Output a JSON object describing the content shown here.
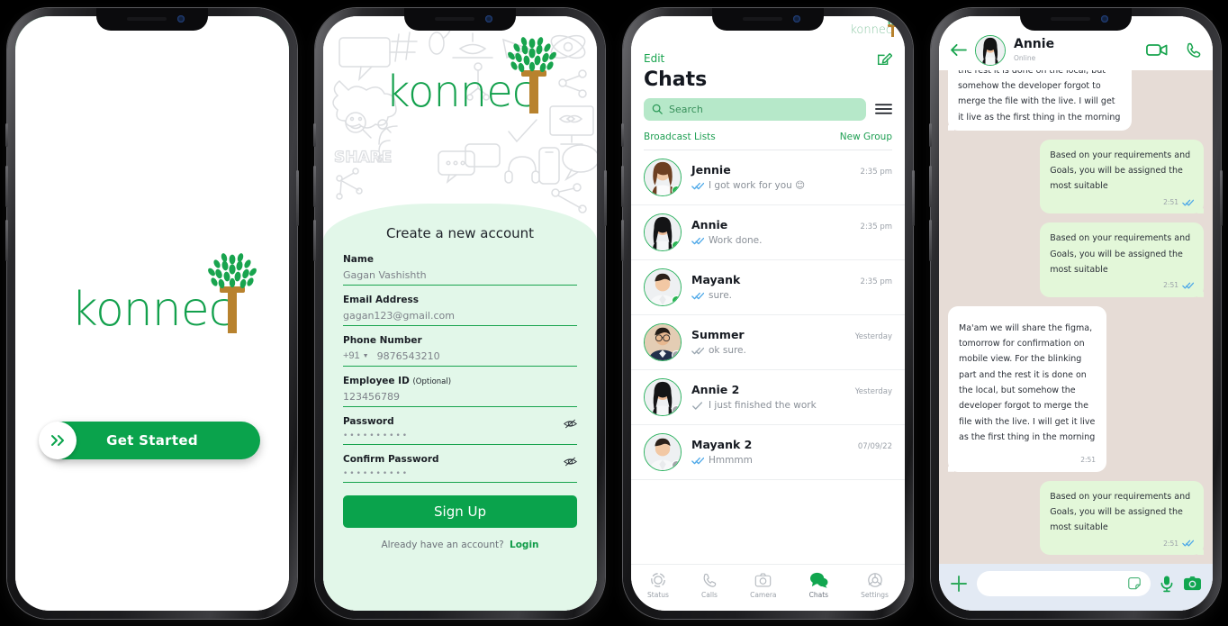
{
  "brand": {
    "name": "konnect",
    "word_part": "konnec",
    "tee_letter": "T",
    "green": "#0aa34c",
    "tree_brown": "#b8822e"
  },
  "phone1": {
    "screen_name": "splash",
    "logo_text": "konnec",
    "cta": {
      "label": "Get Started",
      "icon": "double-chevron-right-icon"
    }
  },
  "phone2": {
    "screen_name": "create-account",
    "logo_text": "konnec",
    "title": "Create a new account",
    "fields": [
      {
        "label": "Name",
        "optional": "",
        "value": "Gagan Vashishth",
        "type": "text"
      },
      {
        "label": "Email Address",
        "optional": "",
        "value": "gagan123@gmail.com",
        "type": "email"
      },
      {
        "label": "Phone Number",
        "optional": "",
        "value": "9876543210",
        "type": "tel",
        "country_code": "+91"
      },
      {
        "label": "Employee ID",
        "optional": "(Optional)",
        "value": "123456789",
        "type": "text"
      },
      {
        "label": "Password",
        "optional": "",
        "value": "••••••••••",
        "type": "password"
      },
      {
        "label": "Confirm Password",
        "optional": "",
        "value": "••••••••••",
        "type": "password"
      }
    ],
    "submit_label": "Sign Up",
    "footer_text": "Already have an account?",
    "footer_link": "Login"
  },
  "phone3": {
    "screen_name": "chats",
    "brand_mark": "konnec",
    "edit_label": "Edit",
    "title": "Chats",
    "compose_icon": "compose-pencil-icon",
    "search_placeholder": "Search",
    "search_icon": "search-icon",
    "menu_icon": "hamburger-menu-icon",
    "broadcast_label": "Broadcast Lists",
    "new_group_label": "New Group",
    "chats": [
      {
        "name": "Jennie",
        "preview": "I got work for you 😊",
        "time": "2:35 pm",
        "ticks": "double-blue",
        "online": true,
        "avatar": "woman-brown-hair"
      },
      {
        "name": "Annie",
        "preview": "Work done.",
        "time": "2:35 pm",
        "ticks": "double-blue",
        "online": true,
        "avatar": "woman-black-hair"
      },
      {
        "name": "Mayank",
        "preview": "sure.",
        "time": "2:35 pm",
        "ticks": "double-blue",
        "online": true,
        "avatar": "man-short-hair"
      },
      {
        "name": "Summer",
        "preview": "ok sure.",
        "time": "Yesterday",
        "ticks": "double-gray",
        "online": false,
        "avatar": "man-glasses"
      },
      {
        "name": "Annie 2",
        "preview": "I just finished the work",
        "time": "Yesterday",
        "ticks": "single-gray",
        "online": false,
        "avatar": "woman-black-hair"
      },
      {
        "name": "Mayank 2",
        "preview": "Hmmmm",
        "time": "07/09/22",
        "ticks": "double-blue",
        "online": false,
        "avatar": "man-short-hair"
      }
    ],
    "tabs": [
      {
        "label": "Status",
        "icon": "status-rings-icon",
        "active": false
      },
      {
        "label": "Calls",
        "icon": "phone-icon",
        "active": false
      },
      {
        "label": "Camera",
        "icon": "camera-icon",
        "active": false
      },
      {
        "label": "Chats",
        "icon": "chat-bubbles-icon",
        "active": true
      },
      {
        "label": "Settings",
        "icon": "gear-icon",
        "active": false
      }
    ]
  },
  "phone4": {
    "screen_name": "conversation",
    "back_icon": "back-arrow-icon",
    "contact_name": "Annie",
    "contact_status": "Online",
    "video_icon": "video-camera-icon",
    "call_icon": "phone-icon",
    "messages": [
      {
        "side": "incoming",
        "text": "mobile view. For the blinking part and the rest it is done on the local, but somehow the developer forgot to merge the file with the live. I will get it live as the first thing in the morning",
        "time": "",
        "ticks": "none",
        "clipped_top": true
      },
      {
        "side": "outgoing",
        "text": "Based on your requirements and Goals, you will be assigned the most suitable",
        "time": "2:51",
        "ticks": "double-blue"
      },
      {
        "side": "outgoing",
        "text": "Based on your requirements and Goals, you will be assigned the most suitable",
        "time": "2:51",
        "ticks": "double-blue"
      },
      {
        "side": "incoming",
        "text": "Ma'am we will share the figma, tomorrow for confirmation on mobile view. For the blinking part and the rest it is done on the local, but somehow the developer forgot to merge the file with the live. I will get it live as the first thing in the morning",
        "time": "2:51",
        "ticks": "none"
      },
      {
        "side": "outgoing",
        "text": "Based on your requirements and Goals, you will be assigned the most suitable",
        "time": "2:51",
        "ticks": "double-blue"
      },
      {
        "side": "outgoing",
        "text": "",
        "time": "",
        "ticks": "none",
        "clipped_bottom": true
      }
    ],
    "composer": {
      "plus_icon": "plus-icon",
      "placeholder": "",
      "sticker_icon": "sticker-icon",
      "mic_icon": "microphone-icon",
      "camera_icon": "camera-icon"
    }
  }
}
